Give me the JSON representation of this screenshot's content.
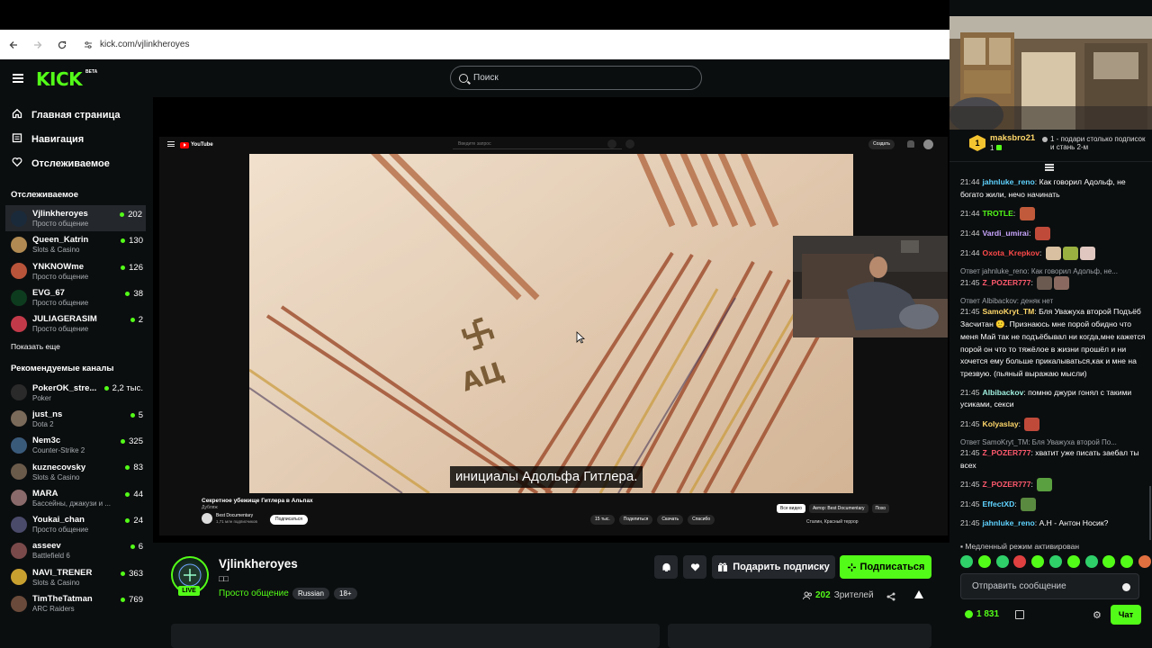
{
  "browser": {
    "url": "kick.com/vjlinkheroyes",
    "icons": {
      "back": "arrow-left-icon",
      "forward": "arrow-right-icon",
      "reload": "reload-icon",
      "site_info": "tune-icon"
    }
  },
  "header": {
    "logo": "KICK",
    "beta": "BETA",
    "search_placeholder": "Поиск"
  },
  "sidebar": {
    "nav": [
      {
        "label": "Главная страница",
        "icon": "home-icon"
      },
      {
        "label": "Навигация",
        "icon": "browse-icon"
      },
      {
        "label": "Отслеживаемое",
        "icon": "heart-icon"
      }
    ],
    "following_title": "Отслеживаемое",
    "following": [
      {
        "name": "Vjlinkheroyes",
        "category": "Просто общение",
        "viewers": "202",
        "color": "#1b2a3a"
      },
      {
        "name": "Queen_Katrin",
        "category": "Slots & Casino",
        "viewers": "130",
        "color": "#b08a52"
      },
      {
        "name": "YNKNOWme",
        "category": "Просто общение",
        "viewers": "126",
        "color": "#b8543a"
      },
      {
        "name": "EVG_67",
        "category": "Просто общение",
        "viewers": "38",
        "color": "#0d3b1e"
      },
      {
        "name": "JULIAGERASIM",
        "category": "Просто общение",
        "viewers": "2",
        "color": "#c23a4a"
      }
    ],
    "show_more": "Показать еще",
    "recommended_title": "Рекомендуемые каналы",
    "recommended": [
      {
        "name": "PokerOK_stre...",
        "category": "Poker",
        "viewers": "2,2 тыс.",
        "color": "#2a2a2a"
      },
      {
        "name": "just_ns",
        "category": "Dota 2",
        "viewers": "5",
        "color": "#7a6a5a"
      },
      {
        "name": "Nem3c",
        "category": "Counter-Strike 2",
        "viewers": "325",
        "color": "#3a5a7a"
      },
      {
        "name": "kuznecovsky",
        "category": "Slots & Casino",
        "viewers": "83",
        "color": "#6a5a4a"
      },
      {
        "name": "MARA",
        "category": "Бассейны, джакузи и ...",
        "viewers": "44",
        "color": "#8a6a6a"
      },
      {
        "name": "Youkai_chan",
        "category": "Просто общение",
        "viewers": "24",
        "color": "#4a4a6a"
      },
      {
        "name": "asseev",
        "category": "Battlefield 6",
        "viewers": "6",
        "color": "#7a4a4a"
      },
      {
        "name": "NAVI_TRENER",
        "category": "Slots & Casino",
        "viewers": "363",
        "color": "#c8a030"
      },
      {
        "name": "TimTheTatman",
        "category": "ARC Raiders",
        "viewers": "769",
        "color": "#6a4a3a"
      }
    ]
  },
  "player": {
    "youtube": {
      "logo_text": "YouTube",
      "search_placeholder": "Введите запрос",
      "create_label": "Создать",
      "video_title": "Секретное убежище Гитлера в Альпах",
      "video_sub": "Дубляж",
      "channel_name": "Best Documentary",
      "channel_subs": "1,71 млн подписчиков",
      "subscribe_label": "Подписаться",
      "actions": [
        "15 тыс.",
        "Поделиться",
        "Скачать",
        "Спасибо"
      ],
      "chips": [
        "Все видео",
        "Автор: Best Documentary",
        "Похо"
      ],
      "recommended_title": "Сталин, Красный террор"
    },
    "subtitle": "инициалы Адольфа Гитлера.",
    "napkin_text": "АЦ"
  },
  "stream": {
    "streamer": "Vjlinkheroyes",
    "title": "□□",
    "live_label": "LIVE",
    "category": "Просто общение",
    "tags": [
      "Russian",
      "18+"
    ],
    "gift_label": "Подарить подписку",
    "follow_label": "Подписаться",
    "viewers": "202",
    "viewers_label": "Зрителей",
    "icons": {
      "bell": "bell-icon",
      "heart": "heart-icon",
      "gift": "gift-icon",
      "follow": "sparkle-icon",
      "viewers": "users-icon",
      "share": "share-icon",
      "report": "warning-icon"
    }
  },
  "chat": {
    "pinned": {
      "rank": "1",
      "user": "maksbro21",
      "count": "1",
      "text": "1 - подари столько подписок и стань 2-м"
    },
    "messages": [
      {
        "time": "21:44",
        "user": "jahnluke_reno",
        "color": "#5fd3ff",
        "text": "Как говорил Адольф, не богато жили, нечо начинать",
        "emotes": []
      },
      {
        "time": "21:44",
        "user": "TROTLE",
        "color": "#53fc18",
        "text": "",
        "emotes": [
          "#c05a3a"
        ]
      },
      {
        "time": "21:44",
        "user": "Vardi_umirai",
        "color": "#c9a6ff",
        "text": "",
        "emotes": [
          "#c04a3a"
        ]
      },
      {
        "time": "21:44",
        "user": "Oxota_Krepkov",
        "color": "#ff4a4a",
        "text": "",
        "emotes": [
          "#d8c0a0",
          "#9ab040",
          "#e0c8c0"
        ]
      },
      {
        "reply": "Ответ jahnluke_reno: Как говорил Адольф, не...",
        "time": "21:45",
        "user": "Z_POZER777",
        "color": "#ff5a6e",
        "text": "",
        "emotes": [
          "#6a5a50",
          "#8a6a60"
        ]
      },
      {
        "reply": "Ответ Albibackov: деняк нет",
        "time": "21:45",
        "user": "SamoKryt_TM",
        "color": "#ffd86b",
        "text": "Бля Уважуха второй Подъёб Засчитан 🙂. Признаюсь мне порой обидно что меня Май так не подъёбывал ни когда,мне кажется порой он что то тяжёлое в жизни прошёл и ни хочется ему больше прикалываться,как и мне на трезвую. (пьяный выражаю мысли)",
        "emotes": []
      },
      {
        "time": "21:45",
        "user": "Albibackov",
        "color": "#a0f0e0",
        "text": "помню джури гонял с такими усиками, секси",
        "emotes": []
      },
      {
        "time": "21:45",
        "user": "Kolyaslay",
        "color": "#ffd86b",
        "text": "",
        "emotes": [
          "#c04a3a"
        ]
      },
      {
        "reply": "Ответ SamoKryt_TM: Бля Уважуха второй По...",
        "time": "21:45",
        "user": "Z_POZER777",
        "color": "#ff5a6e",
        "text": "хватит уже писать заебал ты всех",
        "emotes": []
      },
      {
        "time": "21:45",
        "user": "Z_POZER777",
        "color": "#ff5a6e",
        "text": "",
        "emotes": [
          "#5aa040"
        ]
      },
      {
        "time": "21:45",
        "user": "EffectXD",
        "color": "#5fd3ff",
        "text": "",
        "emotes": [
          "#5a8a40"
        ]
      },
      {
        "time": "21:45",
        "user": "jahnluke_reno",
        "color": "#5fd3ff",
        "text": "А.Н - Антон Носик?",
        "emotes": []
      }
    ],
    "slow_mode": "Медленный режим активирован",
    "input_placeholder": "Отправить сообщение",
    "points": "1 831",
    "chat_button": "Чат",
    "quick_emotes": [
      "#2fd06a",
      "#53fc18",
      "#2fd06a",
      "#e04040",
      "#53fc18",
      "#2fd06a",
      "#53fc18",
      "#2fd06a",
      "#53fc18",
      "#53fc18",
      "#e07040",
      "#53fc18"
    ]
  }
}
